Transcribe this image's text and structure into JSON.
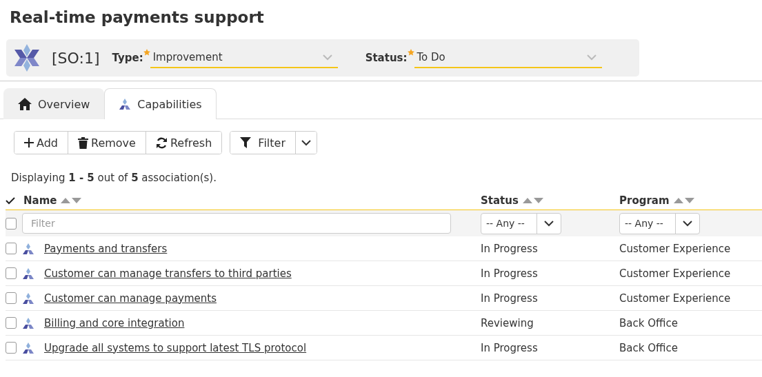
{
  "title": "Real-time payments support",
  "header": {
    "id": "[SO:1]",
    "fields": [
      {
        "label": "Type:",
        "required": true,
        "value": "Improvement"
      },
      {
        "label": "Status:",
        "required": true,
        "value": "To Do"
      }
    ]
  },
  "tabs": [
    {
      "label": "Overview",
      "kind": "home",
      "selected": false
    },
    {
      "label": "Capabilities",
      "kind": "capability",
      "selected": true
    }
  ],
  "toolbar": [
    {
      "label": "Add",
      "kind": "plus"
    },
    {
      "label": "Remove",
      "kind": "trash"
    },
    {
      "label": "Refresh",
      "kind": "refresh"
    }
  ],
  "filter_button": {
    "label": "Filter"
  },
  "summary": "Displaying **1 - 5** out of **5** association(s).",
  "table": {
    "columns": [
      "Name",
      "Status",
      "Program"
    ],
    "filters": {
      "name_placeholder": "Filter",
      "status": "-- Any --",
      "program": "-- Any --"
    },
    "select_all_checked": false,
    "rows": [
      {
        "name": "Payments and transfers",
        "status": "In Progress",
        "program": "Customer Experience",
        "checked": false
      },
      {
        "name": "Customer can manage transfers to third parties",
        "status": "In Progress",
        "program": "Customer Experience",
        "checked": false
      },
      {
        "name": "Customer can manage payments",
        "status": "In Progress",
        "program": "Customer Experience",
        "checked": false
      },
      {
        "name": "Billing and core integration",
        "status": "Reviewing",
        "program": "Back Office",
        "checked": false
      },
      {
        "name": "Upgrade all systems to support latest TLS protocol",
        "status": "In Progress",
        "program": "Back Office",
        "checked": false
      }
    ]
  }
}
